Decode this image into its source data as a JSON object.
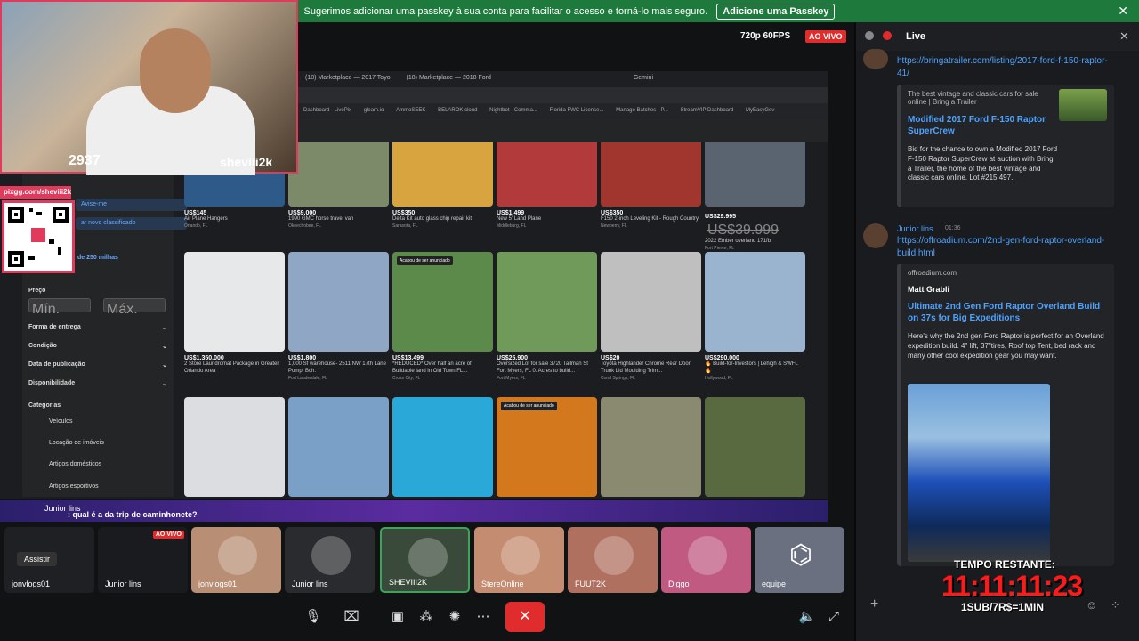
{
  "banner": {
    "text": "Sugerimos adicionar uma passkey à sua conta para facilitar o acesso e torná-lo mais seguro.",
    "button": "Adicione uma Passkey",
    "close": "✕"
  },
  "stream": {
    "quality": "720p 60FPS",
    "live": "AO VIVO",
    "viewer_count": "2937",
    "streamer": "sheviii2k",
    "qr_label": "pixgg.com/sheviii2k"
  },
  "browser": {
    "tabs": [
      "(18) Marketplace — 2017 Toyo",
      "(18) Marketplace — 2018 Ford",
      "Gemini"
    ],
    "bookmarks": [
      "Dashboard - LivePix",
      "gleam.io",
      "AmmoSEEK",
      "BELAROK cloud",
      "Nightbot - Comma...",
      "Florida FWC License...",
      "Manage Batches - P...",
      "StreamVIP Dashboard",
      "MyEasyGov"
    ]
  },
  "fb_sidebar": {
    "avise": "Avise-me",
    "new_listing": "ar novo classificado",
    "radius": "de 250 milhas",
    "price": "Preço",
    "min": "Mín.",
    "max": "Máx.",
    "filters": [
      "Forma de entrega",
      "Condição",
      "Data de publicação",
      "Disponibilidade"
    ],
    "categories_title": "Categorias",
    "categories": [
      "Veículos",
      "Locação de imóveis",
      "Artigos domésticos",
      "Artigos esportivos"
    ]
  },
  "listings": [
    {
      "price": "US$145",
      "title": "Air Plane Hangers",
      "loc": "Orlando, FL",
      "color": "#2e5a8a"
    },
    {
      "price": "US$9.000",
      "title": "1990 GMC horse travel van",
      "loc": "Okeechobee, FL",
      "color": "#7c8a6a"
    },
    {
      "price": "US$350",
      "title": "Delta Kit auto glass chip repair kit",
      "loc": "Sarasota, FL",
      "color": "#d7a440"
    },
    {
      "price": "US$1.499",
      "title": "New 5' Land Plane",
      "loc": "Middleburg, FL",
      "color": "#b23a3a"
    },
    {
      "price": "US$350",
      "title": "F150 2-inch Leveling Kit - Rough Country",
      "loc": "Newberry, FL",
      "color": "#a0362e"
    },
    {
      "price": "US$29.995",
      "title": "2022 Ember overland 171fb",
      "loc": "Fort Pierce, FL",
      "color": "#5a6470",
      "old": "US$39.999"
    },
    {
      "price": "US$1.350.000",
      "title": "2 Store Laundromat Package in Greater Orlando Area",
      "loc": "",
      "color": "#e6e8ea"
    },
    {
      "price": "US$1.800",
      "title": "1,000 Sf warehouse- 2511 NW 17th Lane Pomp. Bch.",
      "loc": "Fort Lauderdale, FL",
      "color": "#8fa6c4"
    },
    {
      "price": "US$13.499",
      "title": "*REDUCED* Over half an acre of Buildable land in Old Town FL...",
      "loc": "Cross City, FL",
      "color": "#5c8a4a",
      "badge": "Acabou de ser anunciado"
    },
    {
      "price": "US$25.900",
      "title": "Oversized Lot for sale 3720 Tallman St Fort Myers, FL 0. Acres to build...",
      "loc": "Fort Myers, FL",
      "color": "#6f9a5a"
    },
    {
      "price": "US$20",
      "title": "Toyota Highlander Chrome Rear Door Trunk Lid Moulding Trim...",
      "loc": "Coral Springs, FL",
      "color": "#bfbfbf"
    },
    {
      "price": "US$290.000",
      "title": "🔥 Build-for-Investors | Lehigh & SWFL 🔥",
      "loc": "Hollywood, FL",
      "color": "#9ab4d0"
    },
    {
      "price": "",
      "title": "",
      "loc": "",
      "color": "#dcdde0"
    },
    {
      "price": "",
      "title": "",
      "loc": "",
      "color": "#7aa0c8"
    },
    {
      "price": "",
      "title": "",
      "loc": "",
      "color": "#2aa8d8"
    },
    {
      "price": "",
      "title": "",
      "loc": "",
      "color": "#d4781e",
      "badge": "Acabou de ser anunciado"
    },
    {
      "price": "",
      "title": "",
      "loc": "",
      "color": "#8a8a70"
    },
    {
      "price": "",
      "title": "",
      "loc": "",
      "color": "#5a6a40"
    }
  ],
  "chat_overlay": {
    "user": "Junior lins",
    "message": ": qual é a da trip de caminhonete?"
  },
  "participants": [
    {
      "name": "jonvlogs01",
      "color": "#1f2023",
      "button": "Assistir"
    },
    {
      "name": "Junior lins",
      "color": "#1a1b1e",
      "live": "AO VIVO"
    },
    {
      "name": "jonvlogs01",
      "color": "#b88f75"
    },
    {
      "name": "Junior lins",
      "color": "#2a2b2e"
    },
    {
      "name": "SHEVIII2K",
      "color": "#3a4a3a"
    },
    {
      "name": "StereOnline",
      "color": "#c48c70"
    },
    {
      "name": "FUUT2K",
      "color": "#b07060"
    },
    {
      "name": "Diggo",
      "color": "#c05a80"
    },
    {
      "name": "equipe",
      "color": "#6a7080"
    }
  ],
  "right_panel": {
    "title": "Live",
    "msg1_link": "https://bringatrailer.com/listing/2017-ford-f-150-raptor-41/",
    "embed1_site": "The best vintage and classic cars for sale online | Bring a Trailer",
    "embed1_title": "Modified 2017 Ford F-150 Raptor SuperCrew",
    "embed1_desc": "Bid for the chance to own a Modified 2017 Ford F-150 Raptor SuperCrew at auction with Bring a Trailer, the home of the best vintage and classic cars online. Lot #215,497.",
    "msg2_user": "Junior lins",
    "msg2_time": "01:36",
    "msg2_link": "https://offroadium.com/2nd-gen-ford-raptor-overland-build.html",
    "embed2_site": "offroadium.com",
    "embed2_author": "Matt Grabli",
    "embed2_title": "Ultimate 2nd Gen Ford Raptor Overland Build on 37s for Big Expeditions",
    "embed2_desc": "Here's why the 2nd gen Ford Raptor is perfect for an Overland expedition build. 4\" lift, 37\"tires, Roof top Tent, bed rack and many other cool expedition gear you may want.",
    "timer_label": "TEMPO RESTANTE:",
    "timer": "11:11:11:23",
    "timer_rate": "1SUB/7R$=1MIN"
  }
}
